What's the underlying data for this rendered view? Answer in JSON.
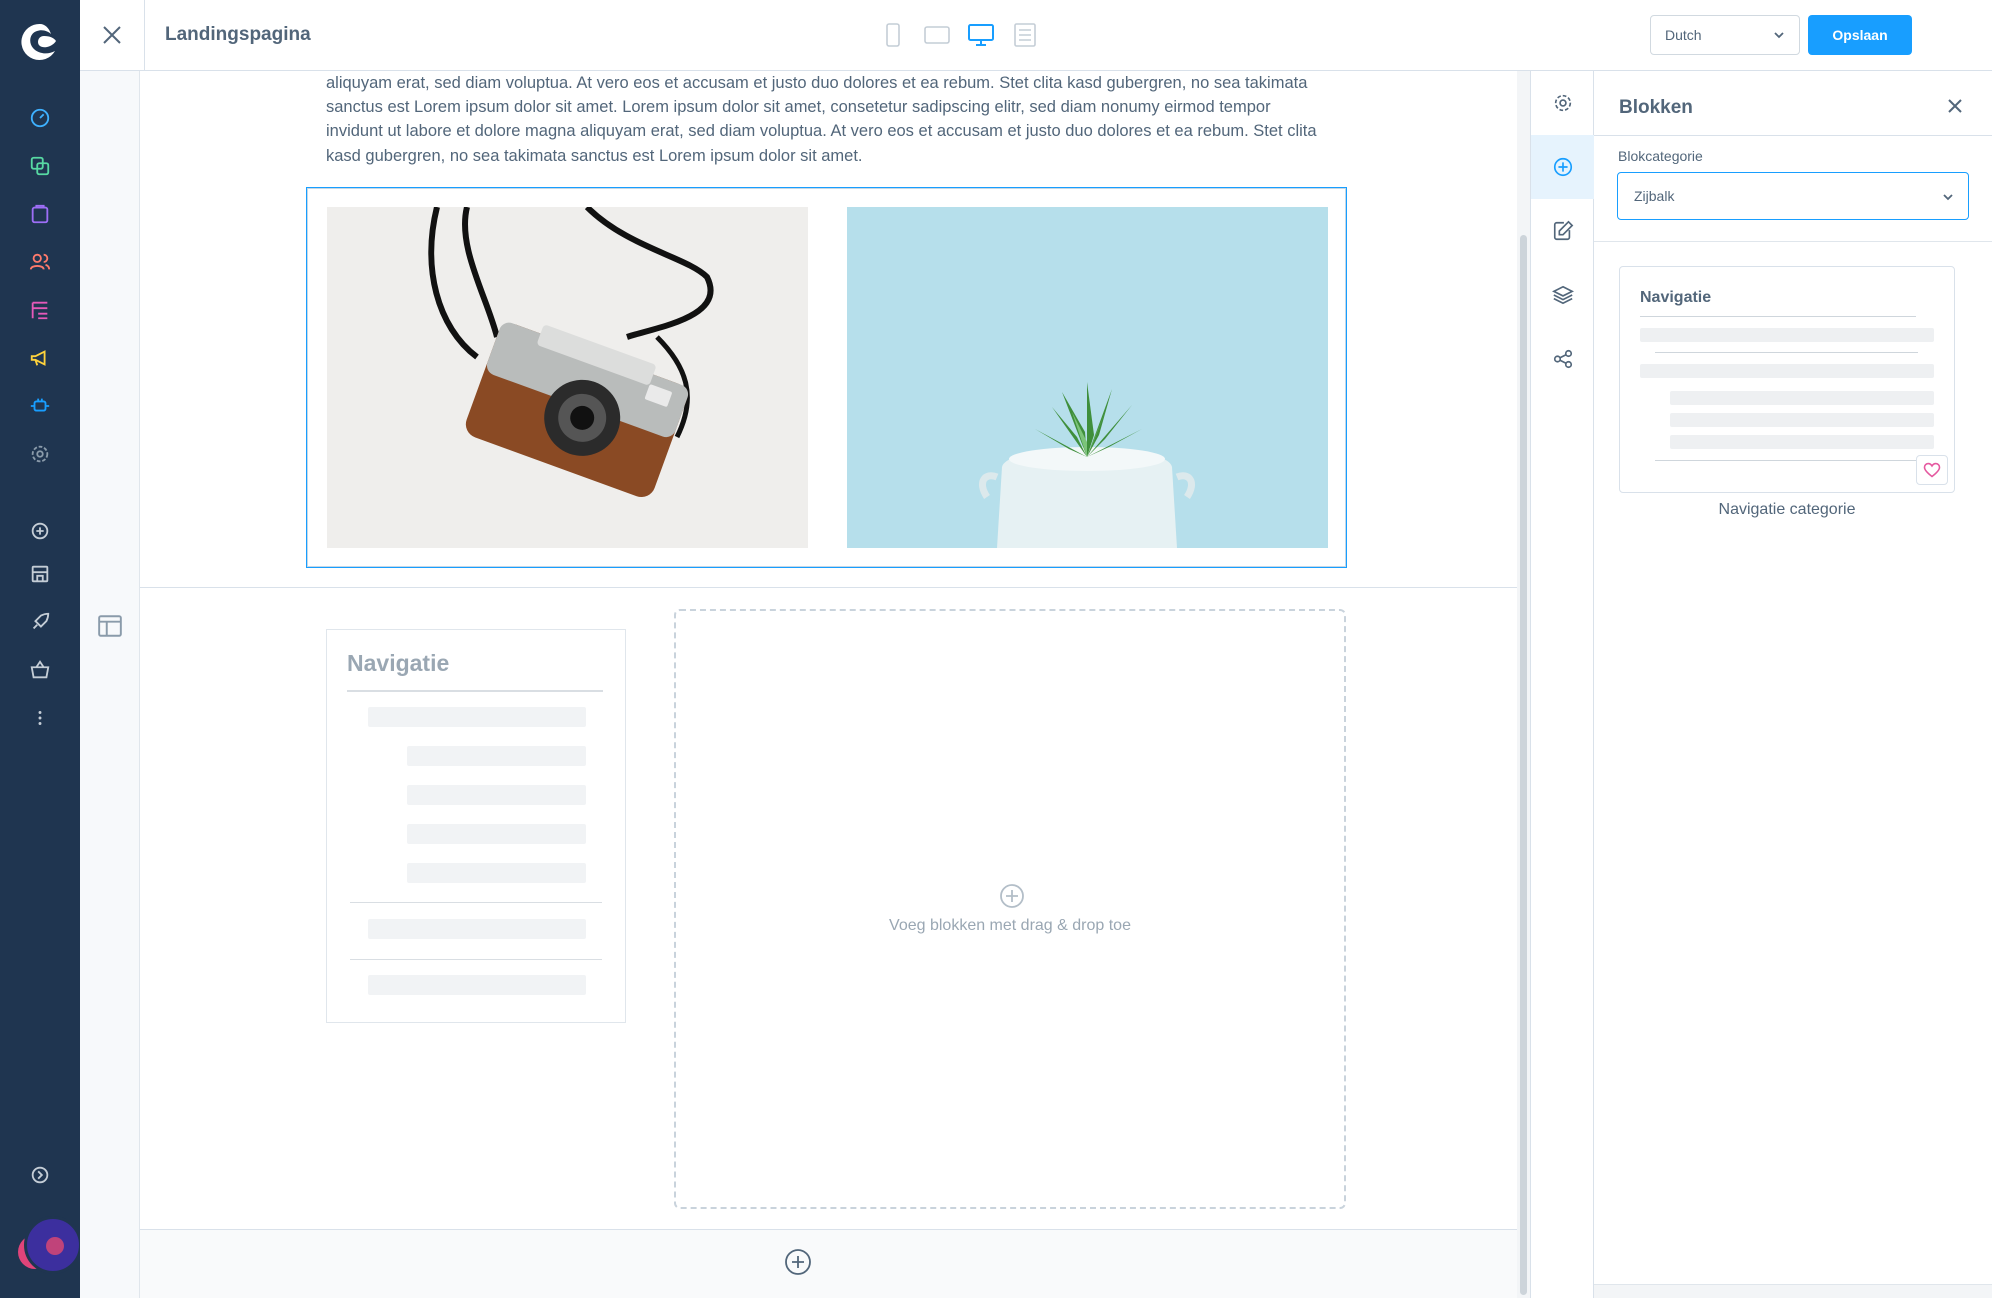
{
  "header": {
    "close_icon": "close-icon",
    "title": "Landingspagina",
    "viewports": [
      "mobile-icon",
      "tablet-icon",
      "desktop-icon",
      "list-icon"
    ],
    "language": "Dutch",
    "save_label": "Opslaan"
  },
  "sidebar": {
    "items": [
      {
        "icon": "dashboard-icon",
        "color": "#3eb1ff"
      },
      {
        "icon": "content-icon",
        "color": "#57d9a3"
      },
      {
        "icon": "catalog-icon",
        "color": "#9d6ef6"
      },
      {
        "icon": "customers-icon",
        "color": "#ff7a6b"
      },
      {
        "icon": "orders-icon",
        "color": "#e559b9"
      },
      {
        "icon": "marketing-icon",
        "color": "#ffd33c"
      },
      {
        "icon": "extensions-icon",
        "color": "#189eff"
      },
      {
        "icon": "settings-icon",
        "color": "#8a9baa"
      },
      {
        "icon": "add-icon",
        "color": "#c4cdd6"
      },
      {
        "icon": "store-icon",
        "color": "#c4cdd6"
      },
      {
        "icon": "rocket-icon",
        "color": "#c4cdd6"
      },
      {
        "icon": "basket-icon",
        "color": "#c4cdd6"
      },
      {
        "icon": "more-icon",
        "color": "#c4cdd6"
      },
      {
        "icon": "collapse-icon",
        "color": "#c4cdd6"
      }
    ]
  },
  "canvas": {
    "lorem": "aliquyam erat, sed diam voluptua. At vero eos et accusam et justo duo dolores et ea rebum. Stet clita kasd gubergren, no sea takimata sanctus est Lorem ipsum dolor sit amet. Lorem ipsum dolor sit amet, consetetur sadipscing elitr, sed diam nonumy eirmod tempor invidunt ut labore et dolore magna aliquyam erat, sed diam voluptua. At vero eos et accusam et justo duo dolores et ea rebum. Stet clita kasd gubergren, no sea takimata sanctus est Lorem ipsum dolor sit amet.",
    "nav_preview_title": "Navigatie",
    "dropzone_text": "Voeg blokken met drag & drop toe"
  },
  "blocks_panel": {
    "title": "Blokken",
    "category_label": "Blokcategorie",
    "category_value": "Zijbalk",
    "card_title": "Navigatie",
    "card_name": "Navigatie categorie"
  },
  "colors": {
    "sidebar_bg": "#1f3550",
    "accent": "#189eff",
    "text": "#52667a"
  }
}
